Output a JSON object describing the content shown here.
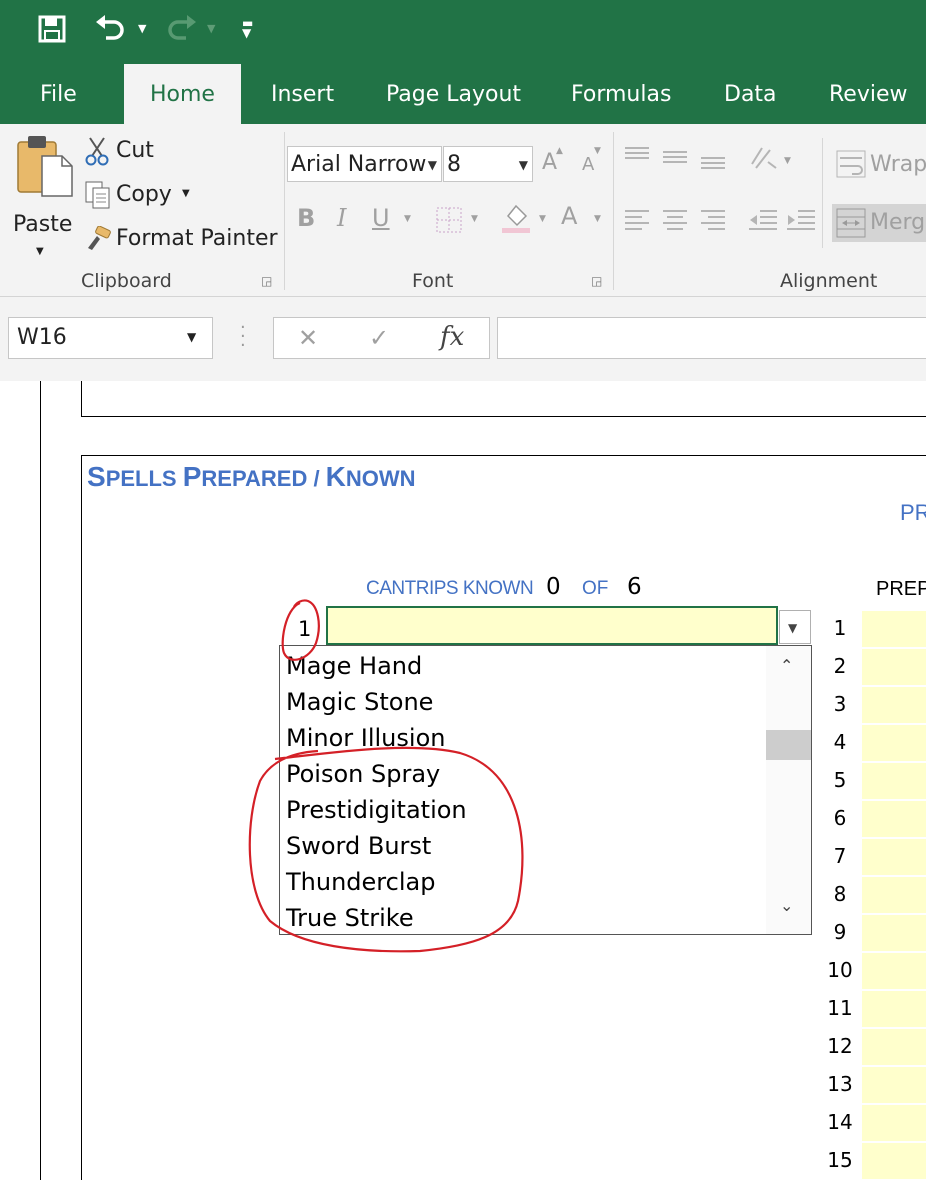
{
  "qat": {
    "save_icon": "save-icon",
    "undo_icon": "undo-icon",
    "redo_icon": "redo-icon",
    "customize_icon": "customize-qat-icon"
  },
  "tabs": [
    "File",
    "Home",
    "Insert",
    "Page Layout",
    "Formulas",
    "Data",
    "Review"
  ],
  "active_tab": "Home",
  "ribbon": {
    "clipboard": {
      "paste": "Paste",
      "cut": "Cut",
      "copy": "Copy",
      "format_painter": "Format Painter",
      "group_label": "Clipboard"
    },
    "font": {
      "font_name": "Arial Narrow",
      "font_size": "8",
      "bold": "B",
      "italic": "I",
      "underline": "U",
      "font_color": "A",
      "grow": "A",
      "shrink": "A",
      "group_label": "Font"
    },
    "alignment": {
      "wrap": "Wrap",
      "merge": "Merg",
      "group_label": "Alignment"
    }
  },
  "formula_bar": {
    "name_box": "W16",
    "cancel": "✕",
    "enter": "✓",
    "fx": "fx",
    "formula": ""
  },
  "sheet": {
    "section_title_big1": "S",
    "section_title_small1": "PELLS ",
    "section_title_big2": "P",
    "section_title_small2": "REPARED / ",
    "section_title_big3": "K",
    "section_title_small3": "NOWN",
    "right_header_cut": "PR",
    "prep_header_cut": "PREP",
    "cantrips_label": "CANTRIPS KNOWN",
    "cantrips_count": "0",
    "of_label": "OF",
    "cantrips_max": "6",
    "active_row_number": "1",
    "dropdown_items": [
      "Mage Hand",
      "Magic Stone",
      "Minor Illusion",
      "Poison Spray",
      "Prestidigitation",
      "Sword Burst",
      "Thunderclap",
      "True Strike"
    ],
    "prepared_rows": [
      "1",
      "2",
      "3",
      "4",
      "5",
      "6",
      "7",
      "8",
      "9",
      "10",
      "11",
      "12",
      "13",
      "14",
      "15"
    ]
  },
  "colors": {
    "excel_green": "#217346",
    "title_blue": "#4472c4",
    "cell_yellow": "#ffffcc",
    "annotation_red": "#d42027"
  }
}
